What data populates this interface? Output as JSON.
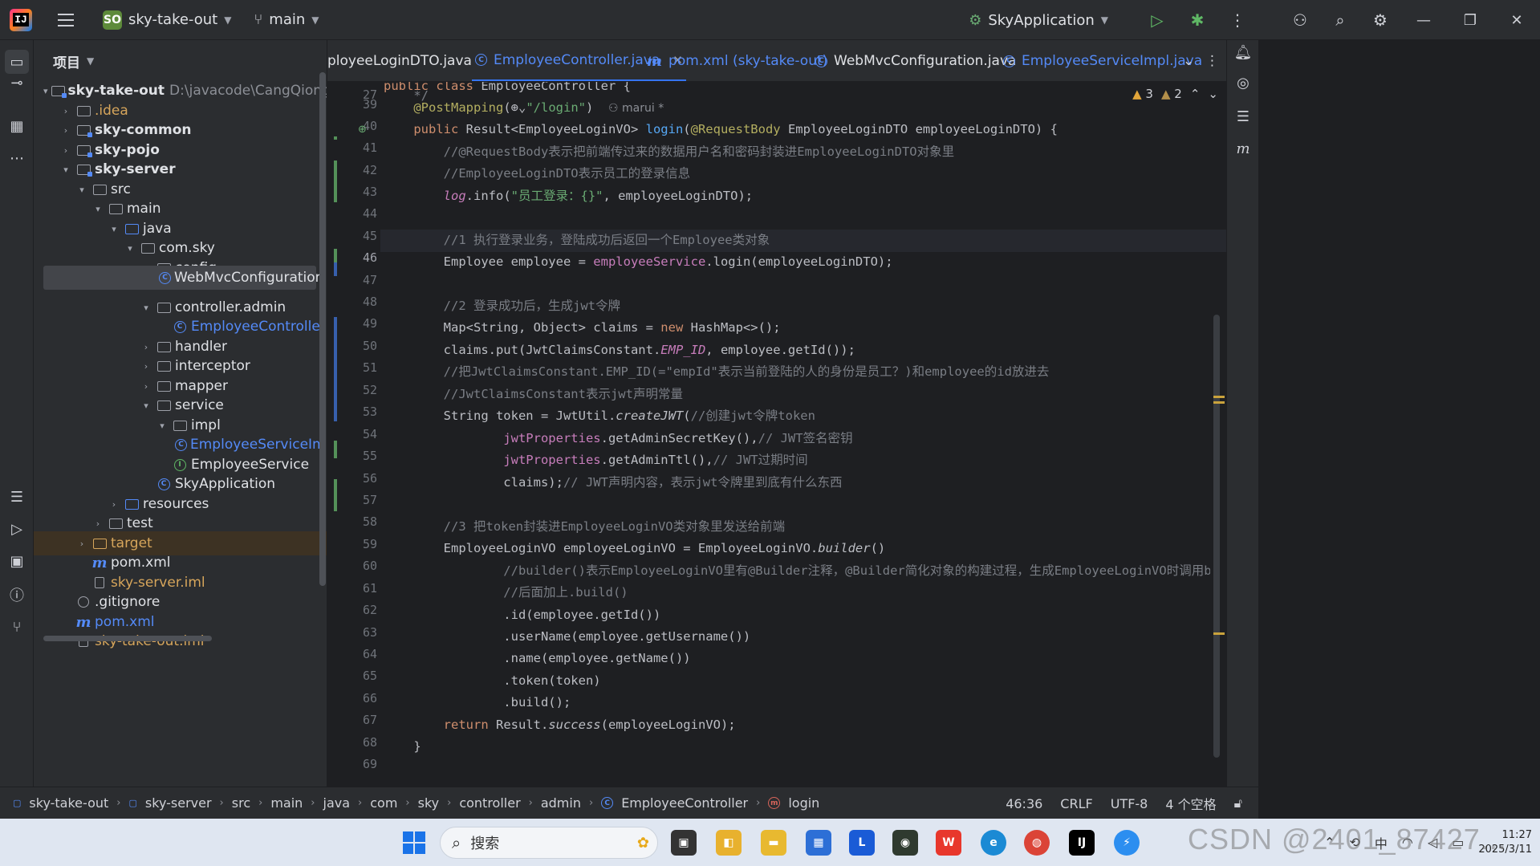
{
  "titlebar": {
    "project_badge": "SO",
    "project_name": "sky-take-out",
    "branch": "main",
    "run_config": "SkyApplication"
  },
  "project_panel": {
    "title": "项目",
    "tree": [
      {
        "label": "sky-take-out",
        "path": "D:\\javacode\\CangQiongWaiMai\\da"
      },
      {
        "label": ".idea"
      },
      {
        "label": "sky-common"
      },
      {
        "label": "sky-pojo"
      },
      {
        "label": "sky-server"
      },
      {
        "label": "src"
      },
      {
        "label": "main"
      },
      {
        "label": "java"
      },
      {
        "label": "com.sky"
      },
      {
        "label": "config"
      },
      {
        "label": "WebMvcConfiguration"
      },
      {
        "label": "controller.admin"
      },
      {
        "label": "EmployeeController"
      },
      {
        "label": "handler"
      },
      {
        "label": "interceptor"
      },
      {
        "label": "mapper"
      },
      {
        "label": "service"
      },
      {
        "label": "impl"
      },
      {
        "label": "EmployeeServiceImpl"
      },
      {
        "label": "EmployeeService"
      },
      {
        "label": "SkyApplication"
      },
      {
        "label": "resources"
      },
      {
        "label": "test"
      },
      {
        "label": "target"
      },
      {
        "label": "pom.xml"
      },
      {
        "label": "sky-server.iml"
      },
      {
        "label": ".gitignore"
      },
      {
        "label": "pom.xml"
      },
      {
        "label": "sky-take-out.iml"
      }
    ]
  },
  "tabs": [
    {
      "label": "ployeeLoginDTO.java"
    },
    {
      "label": "EmployeeController.java"
    },
    {
      "label": "pom.xml (sky-take-out)"
    },
    {
      "label": "WebMvcConfiguration.java"
    },
    {
      "label": "EmployeeServiceImpl.java"
    }
  ],
  "editor": {
    "sticky_header": "public class EmployeeController {",
    "warnings": "3",
    "weak_warnings": "2",
    "author": "marui *",
    "line_numbers": [
      "27",
      "39",
      "40",
      "41",
      "42",
      "43",
      "44",
      "45",
      "46",
      "47",
      "48",
      "49",
      "50",
      "51",
      "52",
      "53",
      "54",
      "55",
      "56",
      "57",
      "58",
      "59",
      "60",
      "61",
      "62",
      "63",
      "64",
      "65",
      "66",
      "67",
      "68",
      "69"
    ]
  },
  "statusbar": {
    "crumbs": [
      "sky-take-out",
      "sky-server",
      "src",
      "main",
      "java",
      "com",
      "sky",
      "controller",
      "admin",
      "EmployeeController",
      "login"
    ],
    "position": "46:36",
    "line_sep": "CRLF",
    "encoding": "UTF-8",
    "indent": "4 个空格"
  },
  "taskbar": {
    "search_placeholder": "搜索",
    "ime": "中",
    "time": "11:27",
    "date": "2025/3/11"
  },
  "watermark": "CSDN @2401_87427..."
}
